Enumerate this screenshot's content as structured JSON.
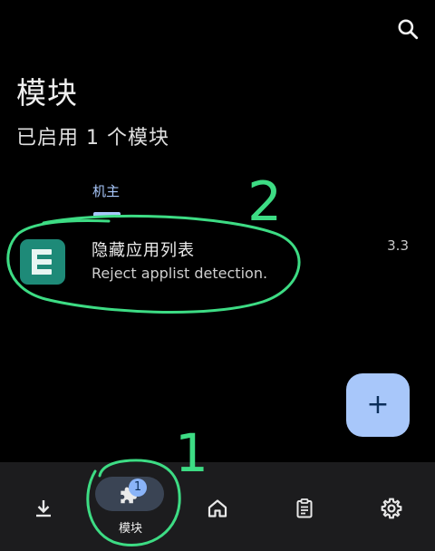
{
  "header": {
    "title": "模块",
    "subtitle": "已启用 1 个模块",
    "search_icon": "search-icon"
  },
  "tabs": [
    {
      "label": "机主",
      "selected": true
    }
  ],
  "modules": [
    {
      "name": "隐藏应用列表",
      "description": "Reject applist detection.",
      "version": "3.3",
      "icon": "hide-my-applist-icon"
    }
  ],
  "fab": {
    "label": "+",
    "icon": "add-icon"
  },
  "bottom_nav": {
    "items": [
      {
        "icon": "download-icon",
        "label": ""
      },
      {
        "icon": "extension-icon",
        "label": "模块",
        "selected": true,
        "badge": "1"
      },
      {
        "icon": "home-icon",
        "label": ""
      },
      {
        "icon": "clipboard-icon",
        "label": ""
      },
      {
        "icon": "gear-icon",
        "label": ""
      }
    ]
  },
  "annotations": {
    "marker_1": "1",
    "marker_2": "2",
    "color": "#3ddc84"
  },
  "colors": {
    "background": "#000000",
    "accent": "#a8c7fa",
    "nav_background": "#1c1c1e",
    "module_icon": "#1e8a78"
  }
}
